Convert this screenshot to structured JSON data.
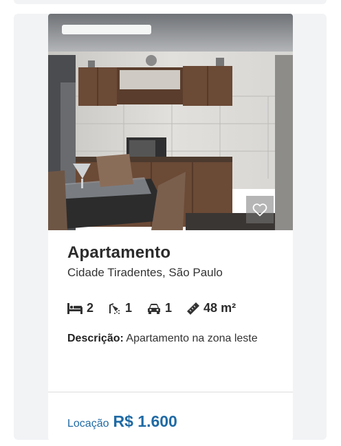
{
  "listing": {
    "title": "Apartamento",
    "location": "Cidade Tiradentes, São Paulo",
    "features": {
      "bedrooms": "2",
      "bathrooms": "1",
      "parking": "1",
      "area": "48 m²"
    },
    "description_label": "Descrição:",
    "description": "Apartamento na zona leste",
    "price_label": "Locação",
    "price": "R$ 1.600"
  },
  "icons": {
    "bedrooms": "bed-icon",
    "bathrooms": "shower-icon",
    "parking": "car-icon",
    "area": "ruler-icon",
    "favorite": "heart-icon"
  },
  "colors": {
    "accent": "#1f6aa5",
    "text": "#2b2b2b",
    "background": "#f2f3f5"
  }
}
